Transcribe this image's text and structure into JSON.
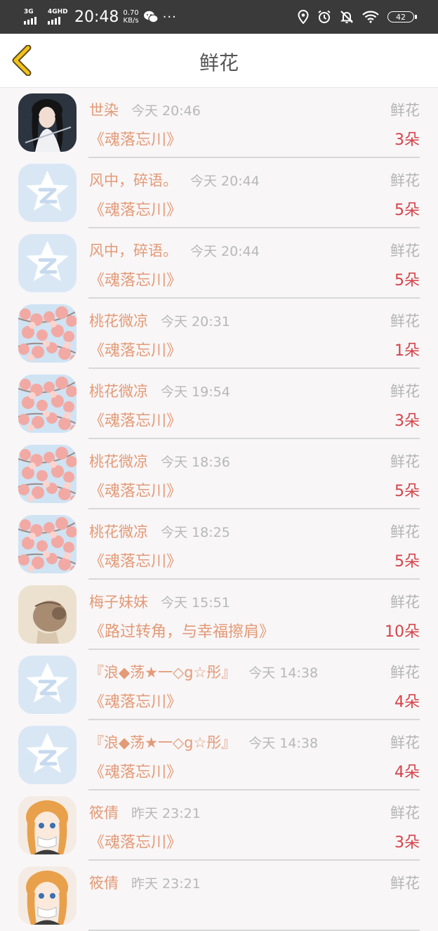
{
  "status_bar": {
    "sim1": "3G",
    "sim2": "4GHD",
    "time": "20:48",
    "speed_value": "0.70",
    "speed_unit": "KB/s",
    "more": "···",
    "battery": "42"
  },
  "header": {
    "title": "鲜花"
  },
  "rows": [
    {
      "name": "世染",
      "time": "今天 20:46",
      "type": "鲜花",
      "book": "《魂落忘川》",
      "count": "3朵",
      "avatar": "portrait"
    },
    {
      "name": "风中，碎语。",
      "time": "今天 20:44",
      "type": "鲜花",
      "book": "《魂落忘川》",
      "count": "5朵",
      "avatar": "qq"
    },
    {
      "name": "风中，碎语。",
      "time": "今天 20:44",
      "type": "鲜花",
      "book": "《魂落忘川》",
      "count": "5朵",
      "avatar": "qq"
    },
    {
      "name": "桃花微凉",
      "time": "今天 20:31",
      "type": "鲜花",
      "book": "《魂落忘川》",
      "count": "1朵",
      "avatar": "blossom"
    },
    {
      "name": "桃花微凉",
      "time": "今天 19:54",
      "type": "鲜花",
      "book": "《魂落忘川》",
      "count": "3朵",
      "avatar": "blossom"
    },
    {
      "name": "桃花微凉",
      "time": "今天 18:36",
      "type": "鲜花",
      "book": "《魂落忘川》",
      "count": "5朵",
      "avatar": "blossom"
    },
    {
      "name": "桃花微凉",
      "time": "今天 18:25",
      "type": "鲜花",
      "book": "《魂落忘川》",
      "count": "5朵",
      "avatar": "blossom"
    },
    {
      "name": "梅子妹妹",
      "time": "今天 15:51",
      "type": "鲜花",
      "book": "《路过转角，与幸福擦肩》",
      "count": "10朵",
      "avatar": "sketch"
    },
    {
      "name": "『浪◆荡★一◇g☆彤』",
      "time": "今天 14:38",
      "type": "鲜花",
      "book": "《魂落忘川》",
      "count": "4朵",
      "avatar": "qq"
    },
    {
      "name": "『浪◆荡★一◇g☆彤』",
      "time": "今天 14:38",
      "type": "鲜花",
      "book": "《魂落忘川》",
      "count": "4朵",
      "avatar": "qq"
    },
    {
      "name": "筱倩",
      "time": "昨天 23:21",
      "type": "鲜花",
      "book": "《魂落忘川》",
      "count": "3朵",
      "avatar": "anime"
    },
    {
      "name": "筱倩",
      "time": "昨天 23:21",
      "type": "鲜花",
      "book": "",
      "count": "",
      "avatar": "anime"
    }
  ],
  "colors": {
    "name": "#e39a77",
    "time": "#b8b8b8",
    "count": "#d5434a",
    "back_arrow": "#f2c21a"
  }
}
